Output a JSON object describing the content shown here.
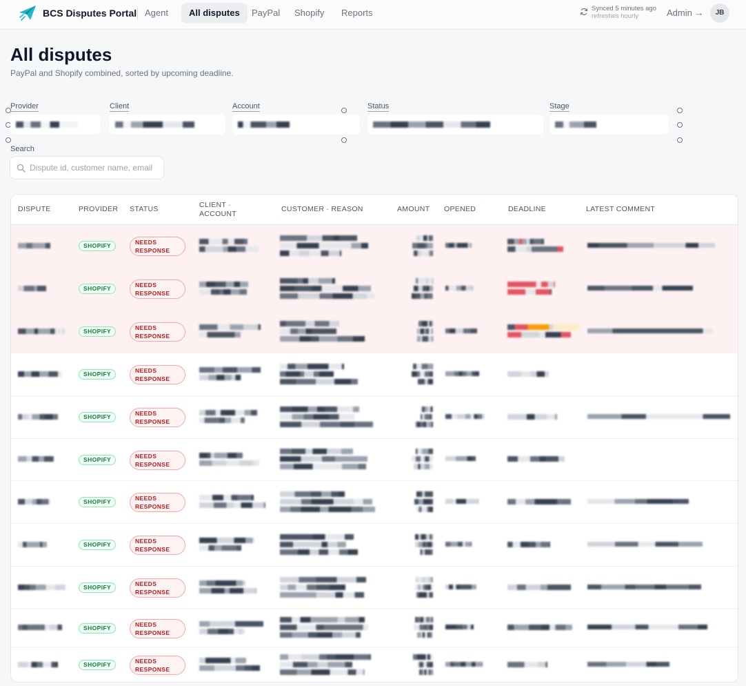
{
  "app": {
    "brand": "BCS Disputes Portal",
    "nav": [
      "Agent",
      "All disputes",
      "PayPal",
      "Shopify",
      "Reports"
    ],
    "active_nav": "All disputes",
    "sync_status": "Synced 5 minutes ago",
    "sync_note": "refreshes hourly",
    "admin_link": "Admin →",
    "user_initials": "JB",
    "accent_color": "#0ea5b7"
  },
  "page": {
    "title": "All disputes",
    "subtitle": "PayPal and Shopify combined, sorted by upcoming deadline."
  },
  "filters": {
    "provider_label": "Provider",
    "client_label": "Client",
    "account_label": "Account",
    "status_label": "Status",
    "stage_label": "Stage",
    "search_label": "Search",
    "search_placeholder": "Dispute id, customer name, email"
  },
  "table": {
    "columns": [
      "DISPUTE",
      "PROVIDER",
      "STATUS",
      "CLIENT · ACCOUNT",
      "CUSTOMER · REASON",
      "AMOUNT",
      "OPENED",
      "DEADLINE",
      "LATEST COMMENT"
    ],
    "rows": [
      {
        "provider": "SHOPIFY",
        "status_line1": "NEEDS",
        "status_line2": "RESPONSE",
        "urgent": true
      },
      {
        "provider": "SHOPIFY",
        "status_line1": "NEEDS",
        "status_line2": "RESPONSE",
        "urgent": true
      },
      {
        "provider": "SHOPIFY",
        "status_line1": "NEEDS",
        "status_line2": "RESPONSE",
        "urgent": true
      },
      {
        "provider": "SHOPIFY",
        "status_line1": "NEEDS",
        "status_line2": "RESPONSE",
        "urgent": false
      },
      {
        "provider": "SHOPIFY",
        "status_line1": "NEEDS",
        "status_line2": "RESPONSE",
        "urgent": false
      },
      {
        "provider": "SHOPIFY",
        "status_line1": "NEEDS",
        "status_line2": "RESPONSE",
        "urgent": false
      },
      {
        "provider": "SHOPIFY",
        "status_line1": "NEEDS",
        "status_line2": "RESPONSE",
        "urgent": false
      },
      {
        "provider": "SHOPIFY",
        "status_line1": "NEEDS",
        "status_line2": "RESPONSE",
        "urgent": false
      },
      {
        "provider": "SHOPIFY",
        "status_line1": "NEEDS",
        "status_line2": "RESPONSE",
        "urgent": false
      },
      {
        "provider": "SHOPIFY",
        "status_line1": "NEEDS",
        "status_line2": "RESPONSE",
        "urgent": false
      },
      {
        "provider": "SHOPIFY",
        "status_line1": "NEEDS",
        "status_line2": "RESPONSE",
        "urgent": false
      }
    ]
  }
}
